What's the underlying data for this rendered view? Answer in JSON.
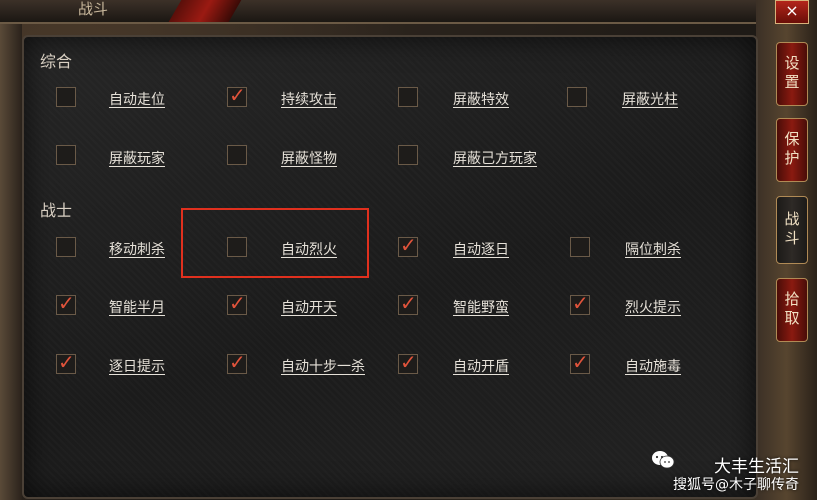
{
  "header": {
    "title": "战斗"
  },
  "tabs": [
    {
      "label": "设置",
      "active": false
    },
    {
      "label": "保护",
      "active": false
    },
    {
      "label": "战斗",
      "active": true
    },
    {
      "label": "拾取",
      "active": false
    }
  ],
  "close_symbol": "×",
  "sections": {
    "general": {
      "title": "综合",
      "items": [
        {
          "label": "自动走位",
          "checked": false
        },
        {
          "label": "持续攻击",
          "checked": true
        },
        {
          "label": "屏蔽特效",
          "checked": false
        },
        {
          "label": "屏蔽光柱",
          "checked": false
        },
        {
          "label": "屏蔽玩家",
          "checked": false
        },
        {
          "label": "屏蔽怪物",
          "checked": false
        },
        {
          "label": "屏蔽己方玩家",
          "checked": false
        }
      ]
    },
    "warrior": {
      "title": "战士",
      "items": [
        {
          "label": "移动刺杀",
          "checked": false
        },
        {
          "label": "自动烈火",
          "checked": false
        },
        {
          "label": "自动逐日",
          "checked": true
        },
        {
          "label": "隔位刺杀",
          "checked": false
        },
        {
          "label": "智能半月",
          "checked": true
        },
        {
          "label": "自动开天",
          "checked": true
        },
        {
          "label": "智能野蛮",
          "checked": true
        },
        {
          "label": "烈火提示",
          "checked": true
        },
        {
          "label": "逐日提示",
          "checked": true
        },
        {
          "label": "自动十步一杀",
          "checked": true
        },
        {
          "label": "自动开盾",
          "checked": true
        },
        {
          "label": "自动施毒",
          "checked": true
        }
      ]
    }
  },
  "check_mark": "✓",
  "watermark": {
    "line1": "大丰生活汇",
    "line2": "搜狐号@木子聊传奇"
  },
  "colors": {
    "accent_red": "#e0301e",
    "check_color": "#e0533b",
    "label_color": "#e6e1d8"
  }
}
